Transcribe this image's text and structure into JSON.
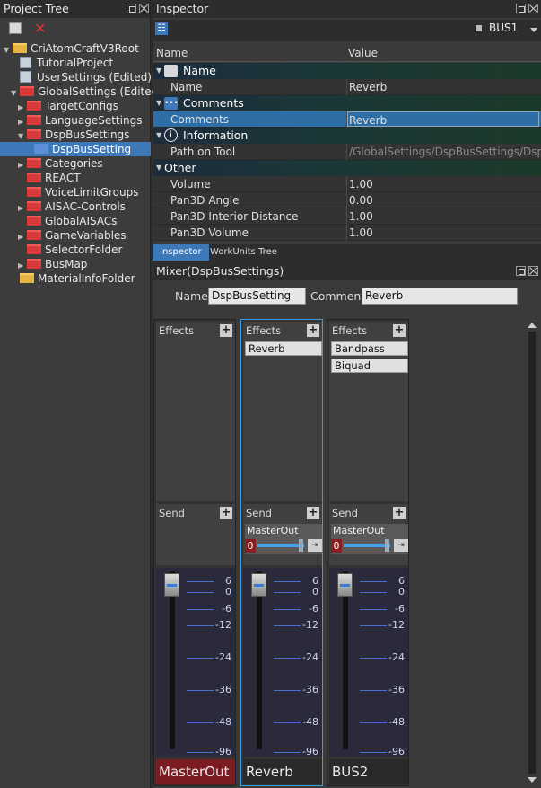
{
  "tree": {
    "title": "Project Tree",
    "items": [
      {
        "label": "CriAtomCraftV3Root",
        "icon": "folder-open-icon"
      },
      {
        "label": "TutorialProject",
        "icon": "project-icon"
      },
      {
        "label": "UserSettings (Edited)",
        "icon": "user-settings-icon"
      },
      {
        "label": "GlobalSettings (Edited)",
        "icon": "folder-open-red-icon"
      },
      {
        "label": "TargetConfigs",
        "icon": "folder-red-icon"
      },
      {
        "label": "LanguageSettings",
        "icon": "folder-red-icon"
      },
      {
        "label": "DspBusSettings",
        "icon": "folder-open-red-icon"
      },
      {
        "label": "DspBusSetting",
        "icon": "dsp-bus-icon"
      },
      {
        "label": "Categories",
        "icon": "folder-red-icon"
      },
      {
        "label": "REACT",
        "icon": "folder-red-icon"
      },
      {
        "label": "VoiceLimitGroups",
        "icon": "folder-red-icon"
      },
      {
        "label": "AISAC-Controls",
        "icon": "folder-red-icon"
      },
      {
        "label": "GlobalAISACs",
        "icon": "folder-red-icon"
      },
      {
        "label": "GameVariables",
        "icon": "folder-red-icon"
      },
      {
        "label": "SelectorFolder",
        "icon": "folder-red-icon"
      },
      {
        "label": "BusMap",
        "icon": "folder-red-icon"
      },
      {
        "label": "MaterialInfoFolder",
        "icon": "folder-yellow-icon"
      }
    ]
  },
  "inspector": {
    "title": "Inspector",
    "bus_label": "BUS1",
    "col_name": "Name",
    "col_value": "Value",
    "categories": {
      "name": "Name",
      "comments": "Comments",
      "information": "Information",
      "other": "Other"
    },
    "rows": {
      "name": {
        "key": "Name",
        "value": "Reverb"
      },
      "comments": {
        "key": "Comments",
        "value": "Reverb"
      },
      "path": {
        "key": "Path on Tool",
        "value": "/GlobalSettings/DspBusSettings/Dsp..."
      },
      "volume": {
        "key": "Volume",
        "value": "1.00"
      },
      "angle": {
        "key": "Pan3D Angle",
        "value": "0.00"
      },
      "interior": {
        "key": "Pan3D Interior Distance",
        "value": "1.00"
      },
      "pvolume": {
        "key": "Pan3D Volume",
        "value": "1.00"
      }
    },
    "tabs": {
      "inspector": "Inspector",
      "workunits": "WorkUnits Tree"
    }
  },
  "mixer": {
    "title": "Mixer(DspBusSettings)",
    "name_label": "Name",
    "name_value": "DspBusSetting",
    "comment_label": "Comment",
    "comment_value": "Reverb",
    "effects_label": "Effects",
    "send_label": "Send",
    "scale": [
      "6",
      "0",
      "-6",
      "-12",
      "-24",
      "-36",
      "-48",
      "-96"
    ],
    "strips": [
      {
        "name": "MasterOut",
        "effects": [],
        "send": null
      },
      {
        "name": "Reverb",
        "effects": [
          "Reverb"
        ],
        "send": {
          "target": "MasterOut",
          "value": "0"
        }
      },
      {
        "name": "BUS2",
        "effects": [
          "Bandpass",
          "Biquad"
        ],
        "send": {
          "target": "MasterOut",
          "value": "0"
        }
      }
    ]
  },
  "colors": {
    "accent": "#3d79b8",
    "master": "#7a1c22",
    "selected_strip": "#3b9de0"
  }
}
